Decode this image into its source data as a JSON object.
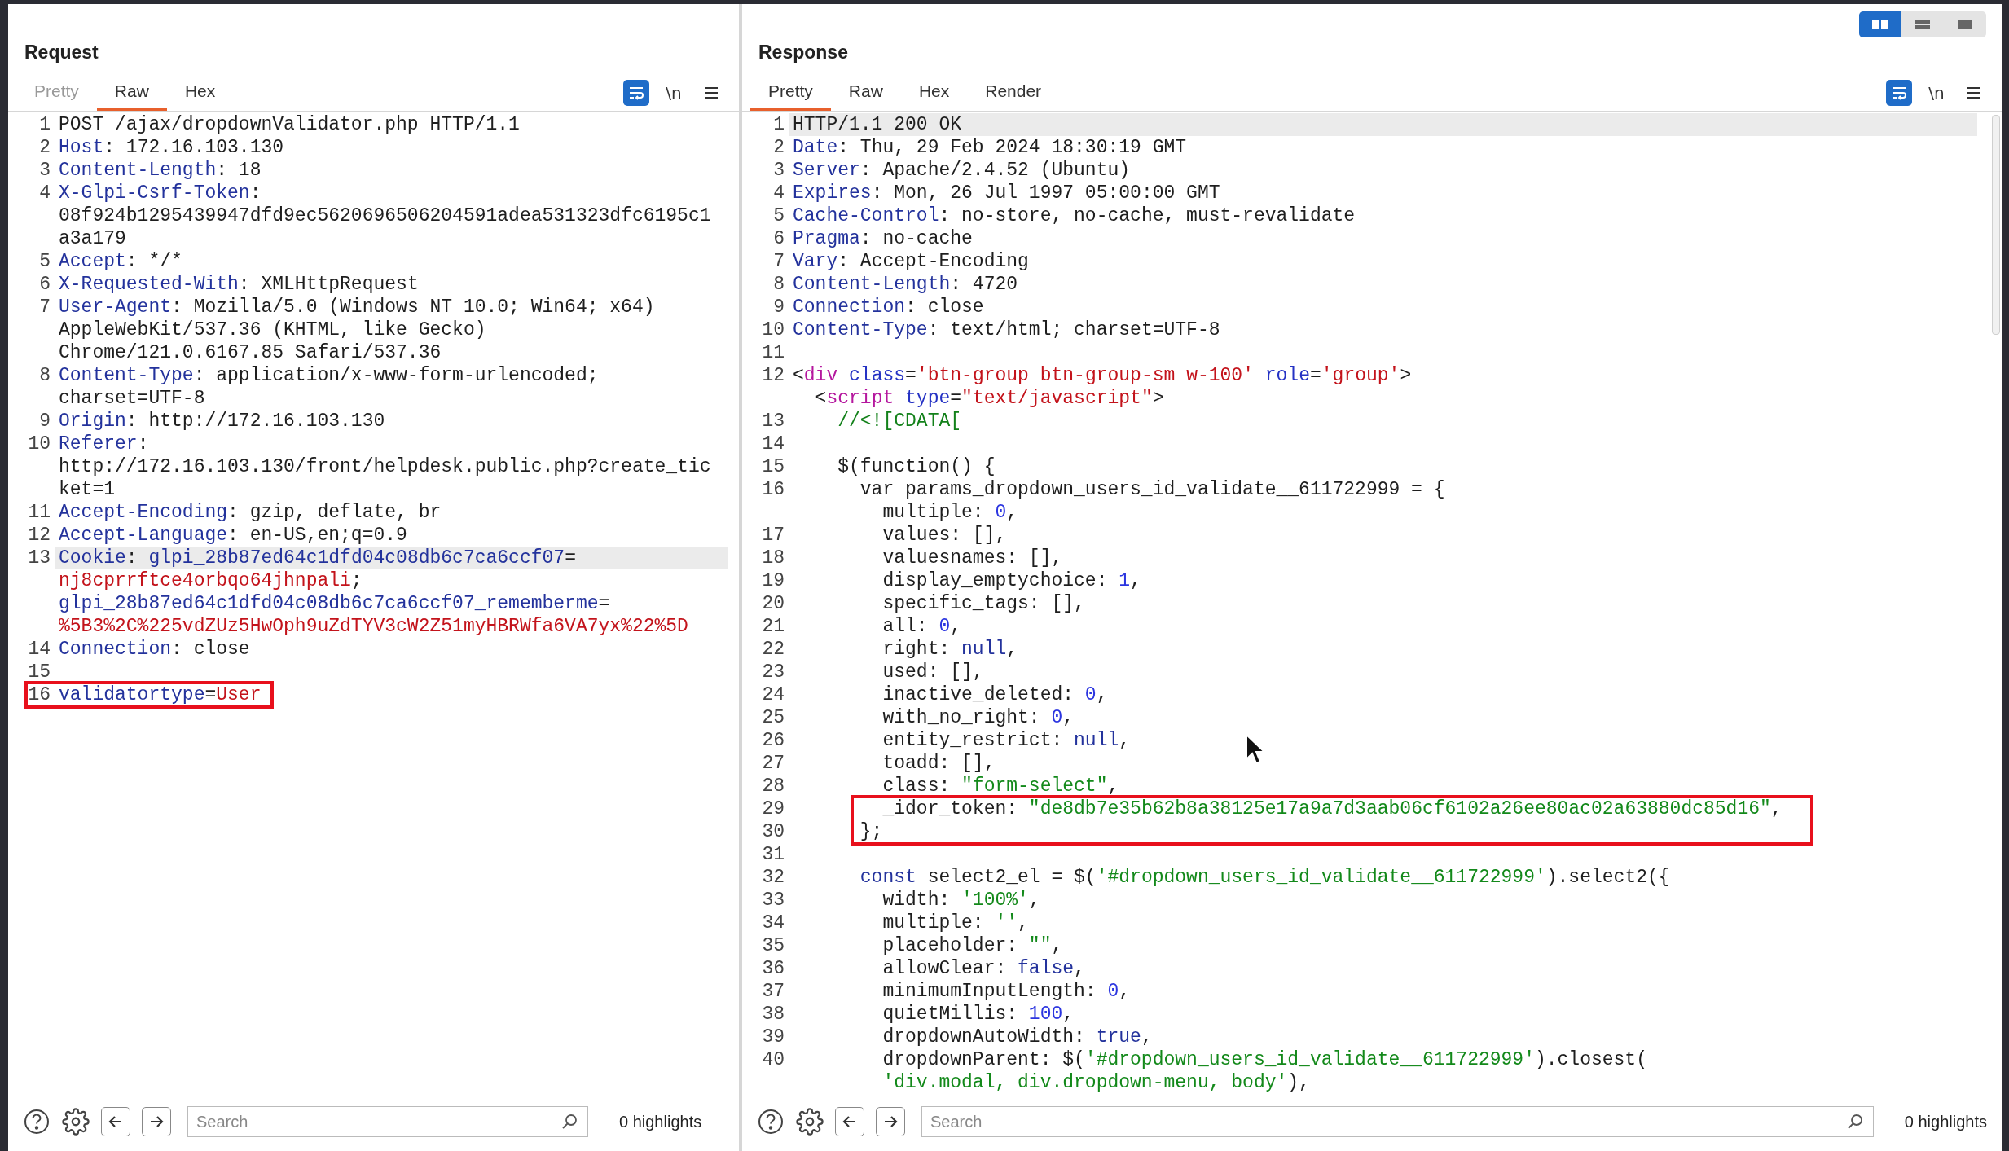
{
  "layout_toggle": [
    {
      "kind": "columns",
      "selected": true
    },
    {
      "kind": "rows",
      "selected": false
    },
    {
      "kind": "single",
      "selected": false
    }
  ],
  "panes": [
    {
      "title": "Request",
      "tabs": [
        {
          "label": "Pretty",
          "selected": false,
          "disabled": true
        },
        {
          "label": "Raw",
          "selected": true,
          "disabled": false
        },
        {
          "label": "Hex",
          "selected": false,
          "disabled": false
        }
      ],
      "tools": [
        {
          "kind": "wrap",
          "on": true
        },
        {
          "kind": "newlines",
          "label": "\\n",
          "on": false
        },
        {
          "kind": "menu",
          "on": false
        }
      ],
      "rows": [
        {
          "number": "1",
          "highlighted": false,
          "boxed": false,
          "tokens": [
            {
              "kind": "plain",
              "text": "POST /ajax/dropdownValidator.php HTTP/1.1"
            }
          ]
        },
        {
          "number": "2",
          "highlighted": false,
          "boxed": false,
          "tokens": [
            {
              "kind": "header",
              "text": "Host"
            },
            {
              "kind": "plain",
              "text": ": 172.16.103.130"
            }
          ]
        },
        {
          "number": "3",
          "highlighted": false,
          "boxed": false,
          "tokens": [
            {
              "kind": "header",
              "text": "Content-Length"
            },
            {
              "kind": "plain",
              "text": ": 18"
            }
          ]
        },
        {
          "number": "4",
          "highlighted": false,
          "boxed": false,
          "tokens": [
            {
              "kind": "header",
              "text": "X-Glpi-Csrf-Token"
            },
            {
              "kind": "plain",
              "text": ":"
            }
          ]
        },
        {
          "highlighted": false,
          "boxed": false,
          "tokens": [
            {
              "kind": "plain",
              "text": "08f924b1295439947dfd9ec5620696506204591adea531323dfc6195c1"
            }
          ]
        },
        {
          "highlighted": false,
          "boxed": false,
          "tokens": [
            {
              "kind": "plain",
              "text": "a3a179"
            }
          ]
        },
        {
          "number": "5",
          "highlighted": false,
          "boxed": false,
          "tokens": [
            {
              "kind": "header",
              "text": "Accept"
            },
            {
              "kind": "plain",
              "text": ": */*"
            }
          ]
        },
        {
          "number": "6",
          "highlighted": false,
          "boxed": false,
          "tokens": [
            {
              "kind": "header",
              "text": "X-Requested-With"
            },
            {
              "kind": "plain",
              "text": ": XMLHttpRequest"
            }
          ]
        },
        {
          "number": "7",
          "highlighted": false,
          "boxed": false,
          "tokens": [
            {
              "kind": "header",
              "text": "User-Agent"
            },
            {
              "kind": "plain",
              "text": ": Mozilla/5.0 (Windows NT 10.0; Win64; x64)"
            }
          ]
        },
        {
          "highlighted": false,
          "boxed": false,
          "tokens": [
            {
              "kind": "plain",
              "text": "AppleWebKit/537.36 (KHTML, like Gecko)"
            }
          ]
        },
        {
          "highlighted": false,
          "boxed": false,
          "tokens": [
            {
              "kind": "plain",
              "text": "Chrome/121.0.6167.85 Safari/537.36"
            }
          ]
        },
        {
          "number": "8",
          "highlighted": false,
          "boxed": false,
          "tokens": [
            {
              "kind": "header",
              "text": "Content-Type"
            },
            {
              "kind": "plain",
              "text": ": application/x-www-form-urlencoded;"
            }
          ]
        },
        {
          "highlighted": false,
          "boxed": false,
          "tokens": [
            {
              "kind": "plain",
              "text": "charset=UTF-8"
            }
          ]
        },
        {
          "number": "9",
          "highlighted": false,
          "boxed": false,
          "tokens": [
            {
              "kind": "header",
              "text": "Origin"
            },
            {
              "kind": "plain",
              "text": ": http://172.16.103.130"
            }
          ]
        },
        {
          "number": "10",
          "highlighted": false,
          "boxed": false,
          "tokens": [
            {
              "kind": "header",
              "text": "Referer"
            },
            {
              "kind": "plain",
              "text": ":"
            }
          ]
        },
        {
          "highlighted": false,
          "boxed": false,
          "tokens": [
            {
              "kind": "plain",
              "text": "http://172.16.103.130/front/helpdesk.public.php?create_tic"
            }
          ]
        },
        {
          "highlighted": false,
          "boxed": false,
          "tokens": [
            {
              "kind": "plain",
              "text": "ket=1"
            }
          ]
        },
        {
          "number": "11",
          "highlighted": false,
          "boxed": false,
          "tokens": [
            {
              "kind": "header",
              "text": "Accept-Encoding"
            },
            {
              "kind": "plain",
              "text": ": gzip, deflate, br"
            }
          ]
        },
        {
          "number": "12",
          "highlighted": false,
          "boxed": false,
          "tokens": [
            {
              "kind": "header",
              "text": "Accept-Language"
            },
            {
              "kind": "plain",
              "text": ": en-US,en;q=0.9"
            }
          ]
        },
        {
          "number": "13",
          "highlighted": true,
          "boxed": false,
          "tokens": [
            {
              "kind": "header",
              "text": "Cookie"
            },
            {
              "kind": "plain",
              "text": ": "
            },
            {
              "kind": "header",
              "text": "glpi_28b87ed64c1dfd04c08db6c7ca6ccf07"
            },
            {
              "kind": "plain",
              "text": "="
            }
          ]
        },
        {
          "highlighted": false,
          "boxed": false,
          "tokens": [
            {
              "kind": "value",
              "text": "nj8cprrftce4orbqo64jhnpali"
            },
            {
              "kind": "plain",
              "text": ";"
            }
          ]
        },
        {
          "highlighted": false,
          "boxed": false,
          "tokens": [
            {
              "kind": "header",
              "text": "glpi_28b87ed64c1dfd04c08db6c7ca6ccf07_rememberme"
            },
            {
              "kind": "plain",
              "text": "="
            }
          ]
        },
        {
          "highlighted": false,
          "boxed": false,
          "tokens": [
            {
              "kind": "value",
              "text": "%5B3%2C%225vdZUz5HwOph9uZdTYV3cW2Z51myHBRWfa6VA7yx%22%5D"
            }
          ]
        },
        {
          "number": "14",
          "highlighted": false,
          "boxed": false,
          "tokens": [
            {
              "kind": "header",
              "text": "Connection"
            },
            {
              "kind": "plain",
              "text": ": close"
            }
          ]
        },
        {
          "number": "15",
          "highlighted": false,
          "boxed": false
        },
        {
          "number": "16",
          "highlighted": false,
          "boxed": true,
          "tokens": [
            {
              "kind": "header",
              "text": "validatortype"
            },
            {
              "kind": "plain",
              "text": "="
            },
            {
              "kind": "value",
              "text": "User"
            }
          ]
        }
      ],
      "footer": {
        "search_placeholder": "Search",
        "highlights": "0 highlights"
      }
    },
    {
      "title": "Response",
      "tabs": [
        {
          "label": "Pretty",
          "selected": true,
          "disabled": false
        },
        {
          "label": "Raw",
          "selected": false,
          "disabled": false
        },
        {
          "label": "Hex",
          "selected": false,
          "disabled": false
        },
        {
          "label": "Render",
          "selected": false,
          "disabled": false
        }
      ],
      "tools": [
        {
          "kind": "wrap",
          "on": true
        },
        {
          "kind": "newlines",
          "label": "\\n",
          "on": false
        },
        {
          "kind": "menu",
          "on": false
        }
      ],
      "rows": [
        {
          "number": "1",
          "highlighted": true,
          "boxed": false,
          "tokens": [
            {
              "kind": "plain",
              "text": "HTTP/1.1 200 OK"
            }
          ]
        },
        {
          "number": "2",
          "highlighted": false,
          "boxed": false,
          "tokens": [
            {
              "kind": "header",
              "text": "Date"
            },
            {
              "kind": "plain",
              "text": ": Thu, 29 Feb 2024 18:30:19 GMT"
            }
          ]
        },
        {
          "number": "3",
          "highlighted": false,
          "boxed": false,
          "tokens": [
            {
              "kind": "header",
              "text": "Server"
            },
            {
              "kind": "plain",
              "text": ": Apache/2.4.52 (Ubuntu)"
            }
          ]
        },
        {
          "number": "4",
          "highlighted": false,
          "boxed": false,
          "tokens": [
            {
              "kind": "header",
              "text": "Expires"
            },
            {
              "kind": "plain",
              "text": ": Mon, 26 Jul 1997 05:00:00 GMT"
            }
          ]
        },
        {
          "number": "5",
          "highlighted": false,
          "boxed": false,
          "tokens": [
            {
              "kind": "header",
              "text": "Cache-Control"
            },
            {
              "kind": "plain",
              "text": ": no-store, no-cache, must-revalidate"
            }
          ]
        },
        {
          "number": "6",
          "highlighted": false,
          "boxed": false,
          "tokens": [
            {
              "kind": "header",
              "text": "Pragma"
            },
            {
              "kind": "plain",
              "text": ": no-cache"
            }
          ]
        },
        {
          "number": "7",
          "highlighted": false,
          "boxed": false,
          "tokens": [
            {
              "kind": "header",
              "text": "Vary"
            },
            {
              "kind": "plain",
              "text": ": Accept-Encoding"
            }
          ]
        },
        {
          "number": "8",
          "highlighted": false,
          "boxed": false,
          "tokens": [
            {
              "kind": "header",
              "text": "Content-Length"
            },
            {
              "kind": "plain",
              "text": ": 4720"
            }
          ]
        },
        {
          "number": "9",
          "highlighted": false,
          "boxed": false,
          "tokens": [
            {
              "kind": "header",
              "text": "Connection"
            },
            {
              "kind": "plain",
              "text": ": close"
            }
          ]
        },
        {
          "number": "10",
          "highlighted": false,
          "boxed": false,
          "tokens": [
            {
              "kind": "header",
              "text": "Content-Type"
            },
            {
              "kind": "plain",
              "text": ": text/html; charset=UTF-8"
            }
          ]
        },
        {
          "number": "11",
          "highlighted": false,
          "boxed": false
        },
        {
          "number": "12",
          "highlighted": false,
          "boxed": false,
          "tokens": [
            {
              "kind": "plain",
              "text": "<"
            },
            {
              "kind": "tag",
              "text": "div"
            },
            {
              "kind": "attr",
              "text": " class"
            },
            {
              "kind": "plain",
              "text": "="
            },
            {
              "kind": "value",
              "text": "'btn-group btn-group-sm w-100'"
            },
            {
              "kind": "attr",
              "text": " role"
            },
            {
              "kind": "plain",
              "text": "="
            },
            {
              "kind": "value",
              "text": "'group'"
            },
            {
              "kind": "plain",
              "text": ">"
            }
          ]
        },
        {
          "highlighted": false,
          "boxed": false,
          "tokens": [
            {
              "kind": "plain",
              "text": "  <"
            },
            {
              "kind": "tag",
              "text": "script"
            },
            {
              "kind": "attr",
              "text": " type"
            },
            {
              "kind": "plain",
              "text": "="
            },
            {
              "kind": "value",
              "text": "\"text/javascript\""
            },
            {
              "kind": "plain",
              "text": ">"
            }
          ]
        },
        {
          "number": "13",
          "highlighted": false,
          "boxed": false,
          "tokens": [
            {
              "kind": "comment",
              "text": "    //<![CDATA["
            }
          ]
        },
        {
          "number": "14",
          "highlighted": false,
          "boxed": false
        },
        {
          "number": "15",
          "highlighted": false,
          "boxed": false,
          "tokens": [
            {
              "kind": "plain",
              "text": "    $(function() {"
            }
          ]
        },
        {
          "number": "16",
          "highlighted": false,
          "boxed": false,
          "tokens": [
            {
              "kind": "plain",
              "text": "      var params_dropdown_users_id_validate__611722999 = {"
            }
          ]
        },
        {
          "highlighted": false,
          "boxed": false,
          "tokens": [
            {
              "kind": "plain",
              "text": "        multiple: "
            },
            {
              "kind": "number",
              "text": "0"
            },
            {
              "kind": "plain",
              "text": ","
            }
          ]
        },
        {
          "number": "17",
          "highlighted": false,
          "boxed": false,
          "tokens": [
            {
              "kind": "plain",
              "text": "        values: [],"
            }
          ]
        },
        {
          "number": "18",
          "highlighted": false,
          "boxed": false,
          "tokens": [
            {
              "kind": "plain",
              "text": "        valuesnames: [],"
            }
          ]
        },
        {
          "number": "19",
          "highlighted": false,
          "boxed": false,
          "tokens": [
            {
              "kind": "plain",
              "text": "        display_emptychoice: "
            },
            {
              "kind": "number",
              "text": "1"
            },
            {
              "kind": "plain",
              "text": ","
            }
          ]
        },
        {
          "number": "20",
          "highlighted": false,
          "boxed": false,
          "tokens": [
            {
              "kind": "plain",
              "text": "        specific_tags: [],"
            }
          ]
        },
        {
          "number": "21",
          "highlighted": false,
          "boxed": false,
          "tokens": [
            {
              "kind": "plain",
              "text": "        all: "
            },
            {
              "kind": "number",
              "text": "0"
            },
            {
              "kind": "plain",
              "text": ","
            }
          ]
        },
        {
          "number": "22",
          "highlighted": false,
          "boxed": false,
          "tokens": [
            {
              "kind": "plain",
              "text": "        right: "
            },
            {
              "kind": "keyword",
              "text": "null"
            },
            {
              "kind": "plain",
              "text": ","
            }
          ]
        },
        {
          "number": "23",
          "highlighted": false,
          "boxed": false,
          "tokens": [
            {
              "kind": "plain",
              "text": "        used: [],"
            }
          ]
        },
        {
          "number": "24",
          "highlighted": false,
          "boxed": false,
          "tokens": [
            {
              "kind": "plain",
              "text": "        inactive_deleted: "
            },
            {
              "kind": "number",
              "text": "0"
            },
            {
              "kind": "plain",
              "text": ","
            }
          ]
        },
        {
          "number": "25",
          "highlighted": false,
          "boxed": false,
          "tokens": [
            {
              "kind": "plain",
              "text": "        with_no_right: "
            },
            {
              "kind": "number",
              "text": "0"
            },
            {
              "kind": "plain",
              "text": ","
            }
          ]
        },
        {
          "number": "26",
          "highlighted": false,
          "boxed": false,
          "tokens": [
            {
              "kind": "plain",
              "text": "        entity_restrict: "
            },
            {
              "kind": "keyword",
              "text": "null"
            },
            {
              "kind": "plain",
              "text": ","
            }
          ]
        },
        {
          "number": "27",
          "highlighted": false,
          "boxed": false,
          "tokens": [
            {
              "kind": "plain",
              "text": "        toadd: [],"
            }
          ]
        },
        {
          "number": "28",
          "highlighted": false,
          "boxed": false,
          "tokens": [
            {
              "kind": "plain",
              "text": "        class: "
            },
            {
              "kind": "string",
              "text": "\"form-select\""
            },
            {
              "kind": "plain",
              "text": ","
            }
          ]
        },
        {
          "number": "29",
          "highlighted": false,
          "boxed": true,
          "tokens": [
            {
              "kind": "plain",
              "text": "        _idor_token: "
            },
            {
              "kind": "string",
              "text": "\"de8db7e35b62b8a38125e17a9a7d3aab06cf6102a26ee80ac02a63880dc85d16\""
            },
            {
              "kind": "plain",
              "text": ","
            }
          ]
        },
        {
          "number": "30",
          "highlighted": false,
          "boxed": true,
          "tokens": [
            {
              "kind": "plain",
              "text": "      };"
            }
          ]
        },
        {
          "number": "31",
          "highlighted": false,
          "boxed": false
        },
        {
          "number": "32",
          "highlighted": false,
          "boxed": false,
          "tokens": [
            {
              "kind": "keyword",
              "text": "      const"
            },
            {
              "kind": "plain",
              "text": " select2_el = $("
            },
            {
              "kind": "string",
              "text": "'#dropdown_users_id_validate__611722999'"
            },
            {
              "kind": "plain",
              "text": ").select2({"
            }
          ]
        },
        {
          "number": "33",
          "highlighted": false,
          "boxed": false,
          "tokens": [
            {
              "kind": "plain",
              "text": "        width: "
            },
            {
              "kind": "string",
              "text": "'100%'"
            },
            {
              "kind": "plain",
              "text": ","
            }
          ]
        },
        {
          "number": "34",
          "highlighted": false,
          "boxed": false,
          "tokens": [
            {
              "kind": "plain",
              "text": "        multiple: "
            },
            {
              "kind": "string",
              "text": "''"
            },
            {
              "kind": "plain",
              "text": ","
            }
          ]
        },
        {
          "number": "35",
          "highlighted": false,
          "boxed": false,
          "tokens": [
            {
              "kind": "plain",
              "text": "        placeholder: "
            },
            {
              "kind": "string",
              "text": "\"\""
            },
            {
              "kind": "plain",
              "text": ","
            }
          ]
        },
        {
          "number": "36",
          "highlighted": false,
          "boxed": false,
          "tokens": [
            {
              "kind": "plain",
              "text": "        allowClear: "
            },
            {
              "kind": "keyword",
              "text": "false"
            },
            {
              "kind": "plain",
              "text": ","
            }
          ]
        },
        {
          "number": "37",
          "highlighted": false,
          "boxed": false,
          "tokens": [
            {
              "kind": "plain",
              "text": "        minimumInputLength: "
            },
            {
              "kind": "number",
              "text": "0"
            },
            {
              "kind": "plain",
              "text": ","
            }
          ]
        },
        {
          "number": "38",
          "highlighted": false,
          "boxed": false,
          "tokens": [
            {
              "kind": "plain",
              "text": "        quietMillis: "
            },
            {
              "kind": "number",
              "text": "100"
            },
            {
              "kind": "plain",
              "text": ","
            }
          ]
        },
        {
          "number": "39",
          "highlighted": false,
          "boxed": false,
          "tokens": [
            {
              "kind": "plain",
              "text": "        dropdownAutoWidth: "
            },
            {
              "kind": "keyword",
              "text": "true"
            },
            {
              "kind": "plain",
              "text": ","
            }
          ]
        },
        {
          "number": "40",
          "highlighted": false,
          "boxed": false,
          "tokens": [
            {
              "kind": "plain",
              "text": "        dropdownParent: $("
            },
            {
              "kind": "string",
              "text": "'#dropdown_users_id_validate__611722999'"
            },
            {
              "kind": "plain",
              "text": ").closest("
            }
          ]
        },
        {
          "highlighted": false,
          "boxed": false,
          "tokens": [
            {
              "kind": "string",
              "text": "        'div.modal, div.dropdown-menu, body'"
            },
            {
              "kind": "plain",
              "text": "),"
            }
          ]
        }
      ],
      "footer": {
        "search_placeholder": "Search",
        "highlights": "0 highlights"
      }
    }
  ]
}
